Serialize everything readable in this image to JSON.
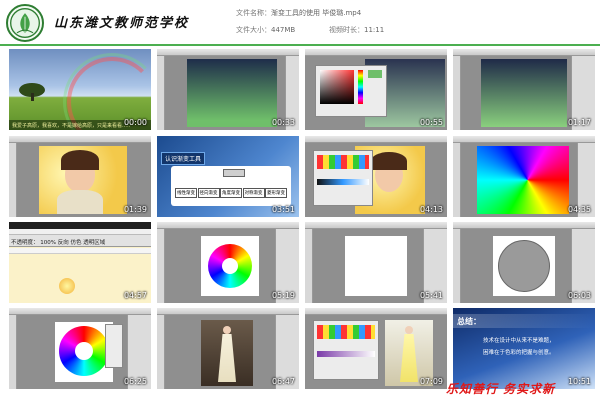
{
  "header": {
    "school_name": "山东潍文教师范学校",
    "file_name_label": "文件名称：",
    "file_name": "渐变工具的使用 毕俊璐.mp4",
    "file_size_label": "文件大小：",
    "file_size": "447MB",
    "duration_label": "视频时长：",
    "duration": "11:11"
  },
  "thumbnails": [
    {
      "timestamp": "00:00",
      "scene": "rainbow-landscape"
    },
    {
      "timestamp": "00:33",
      "scene": "gradient-canvas"
    },
    {
      "timestamp": "00:55",
      "scene": "color-picker-dialog"
    },
    {
      "timestamp": "01:17",
      "scene": "gradient-canvas-panels"
    },
    {
      "timestamp": "01:39",
      "scene": "portrait-photo"
    },
    {
      "timestamp": "03:51",
      "scene": "mindmap-slide"
    },
    {
      "timestamp": "04:13",
      "scene": "gradient-editor-portrait"
    },
    {
      "timestamp": "04:35",
      "scene": "angle-gradient"
    },
    {
      "timestamp": "04:57",
      "scene": "gradient-options-bar"
    },
    {
      "timestamp": "05:19",
      "scene": "color-wheel"
    },
    {
      "timestamp": "05:41",
      "scene": "blank-canvas"
    },
    {
      "timestamp": "06:03",
      "scene": "gray-circle"
    },
    {
      "timestamp": "06:25",
      "scene": "color-wheel-large"
    },
    {
      "timestamp": "06:47",
      "scene": "woman-dress"
    },
    {
      "timestamp": "07:09",
      "scene": "woman-dress-editor"
    },
    {
      "timestamp": "10:51",
      "scene": "summary-slide"
    }
  ],
  "slides": {
    "mindmap_title": "认识渐变工具",
    "mindmap_nodes": [
      "线性渐变",
      "径向渐变",
      "角度渐变",
      "对称渐变",
      "菱形渐变"
    ],
    "summary_title": "总结：",
    "summary_line1": "技术在设计中从来不是难题，",
    "summary_line2": "困难在于色彩的把握与创意。",
    "options_bar_line": "不透明度： 100% 反向 仿色 透明区域",
    "portrait_caption": "我爱子高原，我喜欢，不是嫁给高原，只是来看看……"
  },
  "footer": {
    "motto": "乐知善行 务实求新"
  },
  "colors": {
    "accent": "#4caf50",
    "motto": "#e01818",
    "timestamp": "#ffffff"
  }
}
